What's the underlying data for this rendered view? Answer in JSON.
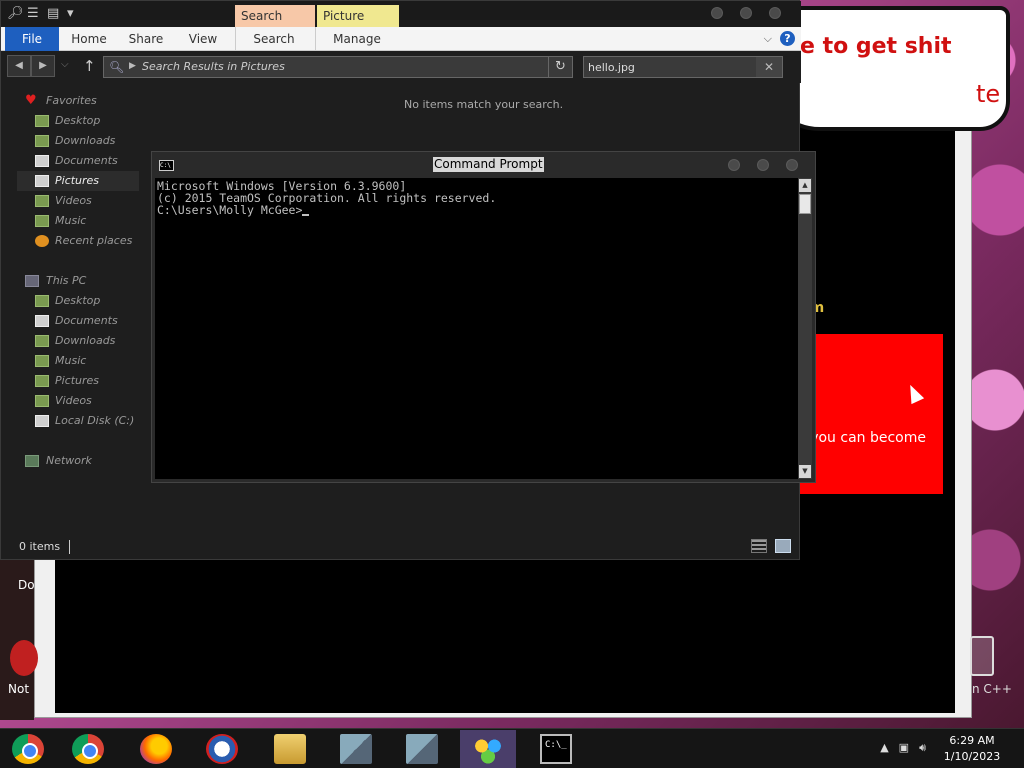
{
  "background": {
    "speech_text": "e to get shit",
    "speech_text2": "te",
    "promo_text": "om",
    "red_box_text": "r you can become",
    "left_text1": "Do",
    "left_text2": "Not",
    "cpp_label": "n C++"
  },
  "explorer": {
    "contextual_tabs": {
      "search_tools": "Search Tools",
      "picture_tools": "Picture Tools"
    },
    "ribbon_tabs": {
      "file": "File",
      "home": "Home",
      "share": "Share",
      "view": "View",
      "search": "Search",
      "manage": "Manage"
    },
    "help_label": "?",
    "address": {
      "text": "Search Results in Pictures"
    },
    "search": {
      "value": "hello.jpg"
    },
    "no_items_message": "No items match your search.",
    "status": {
      "count": "0 items"
    },
    "nav": {
      "favorites": "Favorites",
      "fav_desktop": "Desktop",
      "fav_downloads": "Downloads",
      "fav_documents": "Documents",
      "fav_pictures": "Pictures",
      "fav_videos": "Videos",
      "fav_music": "Music",
      "fav_recent": "Recent places",
      "this_pc": "This PC",
      "pc_desktop": "Desktop",
      "pc_documents": "Documents",
      "pc_downloads": "Downloads",
      "pc_music": "Music",
      "pc_pictures": "Pictures",
      "pc_videos": "Videos",
      "pc_local_disk": "Local Disk (C:)",
      "network": "Network"
    }
  },
  "cmd": {
    "title": "Command Prompt",
    "icon_text": "C:\\",
    "line1": "Microsoft Windows [Version 6.3.9600]",
    "line2": "(c) 2015 TeamOS Corporation. All rights reserved.",
    "line3": "",
    "prompt": "C:\\Users\\Molly McGee>"
  },
  "taskbar": {
    "cmd_icon_text": "C:\\_",
    "time": "6:29 AM",
    "date": "1/10/2023"
  }
}
